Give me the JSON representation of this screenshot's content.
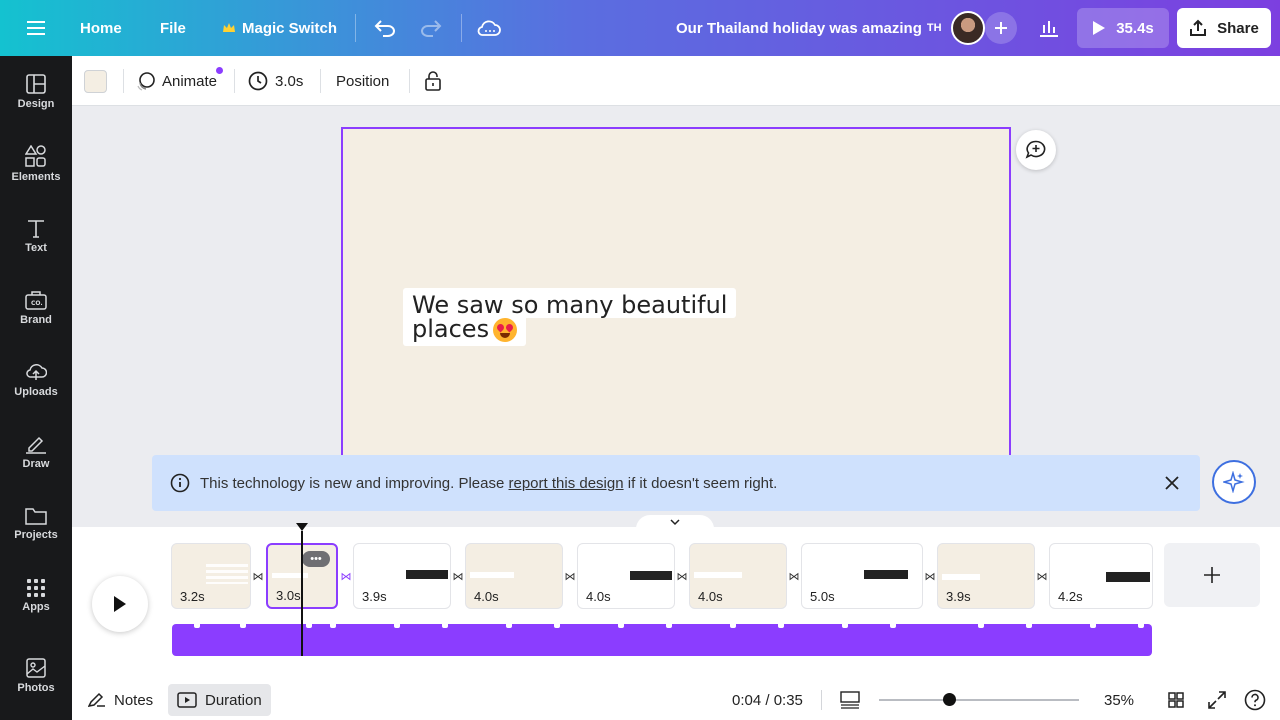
{
  "header": {
    "home": "Home",
    "file": "File",
    "magic_switch": "Magic Switch",
    "title": "Our Thailand holiday was amazing",
    "title_suffix": "TH",
    "present_time": "35.4s",
    "share": "Share"
  },
  "sidebar": {
    "items": [
      {
        "label": "Design"
      },
      {
        "label": "Elements"
      },
      {
        "label": "Text"
      },
      {
        "label": "Brand"
      },
      {
        "label": "Uploads"
      },
      {
        "label": "Draw"
      },
      {
        "label": "Projects"
      },
      {
        "label": "Apps"
      },
      {
        "label": "Photos"
      }
    ]
  },
  "toolbar": {
    "bg_color": "#f4eee3",
    "animate": "Animate",
    "duration": "3.0s",
    "position": "Position"
  },
  "canvas": {
    "line1": "We saw so many beautiful",
    "line2": "places"
  },
  "notice": {
    "before": "This technology is new and improving. Please ",
    "link": "report this design",
    "after": " if it doesn't seem right."
  },
  "scenes": [
    {
      "duration": "3.2s"
    },
    {
      "duration": "3.0s"
    },
    {
      "duration": "3.9s"
    },
    {
      "duration": "4.0s"
    },
    {
      "duration": "4.0s"
    },
    {
      "duration": "4.0s"
    },
    {
      "duration": "5.0s"
    },
    {
      "duration": "3.9s"
    },
    {
      "duration": "4.2s"
    }
  ],
  "footer": {
    "notes": "Notes",
    "duration": "Duration",
    "time": "0:04 / 0:35",
    "zoom": "35%",
    "zoom_level": 0.35
  },
  "colors": {
    "accent": "#8b3dff",
    "notice_bg": "#cfe1fd"
  }
}
